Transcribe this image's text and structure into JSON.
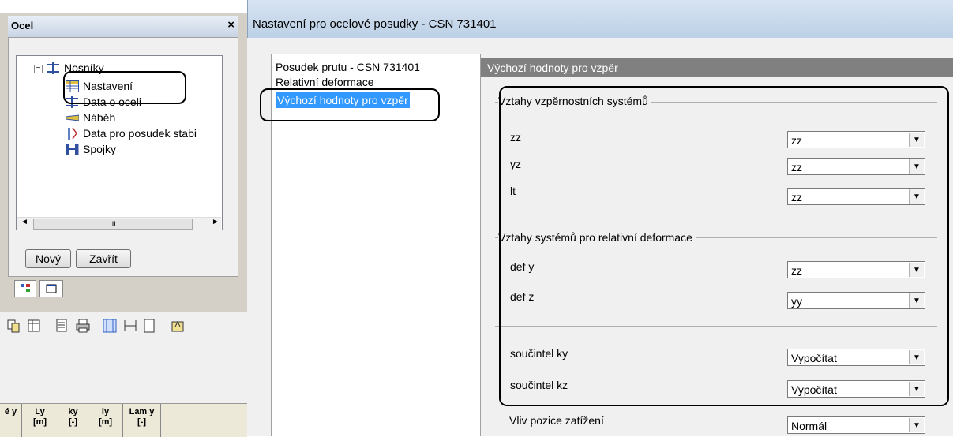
{
  "left_panel": {
    "title": "Ocel",
    "close_glyph": "×",
    "tree": {
      "root": "Nosníky",
      "children": [
        "Nastavení",
        "Data o oceli",
        "Náběh",
        "Data pro posudek stabi",
        "Spojky"
      ]
    },
    "scroll_thumb": "III",
    "buttons": {
      "new": "Nový",
      "close": "Zavřít"
    },
    "columns": [
      {
        "top": "é y",
        "bottom": ""
      },
      {
        "top": "Ly",
        "bottom": "[m]"
      },
      {
        "top": "ky",
        "bottom": "[-]"
      },
      {
        "top": "ly",
        "bottom": "[m]"
      },
      {
        "top": "Lam y",
        "bottom": "[-]"
      }
    ]
  },
  "dialog": {
    "title": "Nastavení pro ocelové posudky - CSN 731401",
    "nav": [
      "Posudek prutu - CSN 731401",
      "Relativní deformace",
      "Výchozí hodnoty pro vzpěr"
    ],
    "selected_nav": "Výchozí hodnoty pro vzpěr",
    "header": "Výchozí hodnoty pro vzpěr",
    "group1": {
      "title": "Vztahy vzpěrnostních systémů",
      "rows": [
        {
          "label": "zz",
          "value": "zz"
        },
        {
          "label": "yz",
          "value": "zz"
        },
        {
          "label": "lt",
          "value": "zz"
        }
      ]
    },
    "group2": {
      "title": "Vztahy systémů pro relativní deformace",
      "rows": [
        {
          "label": "def y",
          "value": "zz"
        },
        {
          "label": "def z",
          "value": "yy"
        }
      ]
    },
    "group3": {
      "rows": [
        {
          "label": "součintel ky",
          "value": "Vypočítat"
        },
        {
          "label": "součintel kz",
          "value": "Vypočítat"
        }
      ]
    },
    "load_position": {
      "label": "Vliv pozice zatížení",
      "value": "Normál"
    }
  }
}
